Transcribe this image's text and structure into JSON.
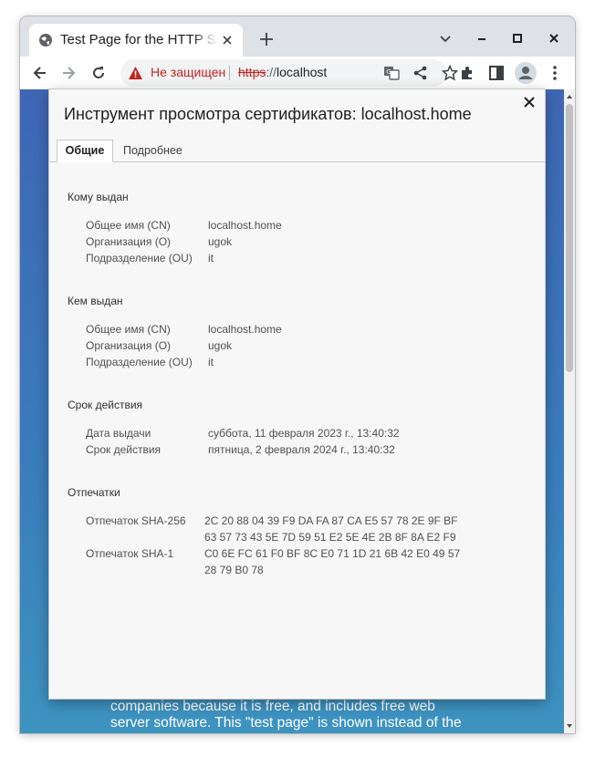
{
  "browser": {
    "tab_title": "Test Page for the HTTP Server on Fedora",
    "security_label": "Не защищен",
    "url_scheme": "https",
    "url_sep": "://",
    "url_host": "localhost"
  },
  "page": {
    "text_lines": [
      "companies because it is free, and includes free web",
      "server software. This \"test page\" is shown instead of the"
    ]
  },
  "dialog": {
    "title": "Инструмент просмотра сертификатов: localhost.home",
    "tabs": [
      "Общие",
      "Подробнее"
    ],
    "issued_to": {
      "title": "Кому выдан",
      "rows": [
        {
          "label": "Общее имя (CN)",
          "value": "localhost.home"
        },
        {
          "label": "Организация (O)",
          "value": "ugok"
        },
        {
          "label": "Подразделение (OU)",
          "value": "it"
        }
      ]
    },
    "issued_by": {
      "title": "Кем выдан",
      "rows": [
        {
          "label": "Общее имя (CN)",
          "value": "localhost.home"
        },
        {
          "label": "Организация (O)",
          "value": "ugok"
        },
        {
          "label": "Подразделение (OU)",
          "value": "it"
        }
      ]
    },
    "validity": {
      "title": "Срок действия",
      "rows": [
        {
          "label": "Дата выдачи",
          "value": "суббота, 11 февраля 2023 г., 13:40:32"
        },
        {
          "label": "Срок действия",
          "value": "пятница, 2 февраля 2024 г., 13:40:32"
        }
      ]
    },
    "fingerprints": {
      "title": "Отпечатки",
      "sha256_label": "Отпечаток SHA-256",
      "sha256_lines": [
        "2C 20 88 04 39 F9 DA FA 87 CA E5 57 78 2E 9F BF",
        "63 57 73 43 5E 7D 59 51 E2 5E 4E 2B 8F 8A E2 F9"
      ],
      "sha1_label": "Отпечаток SHA-1",
      "sha1_lines": [
        "C0 6E FC 61 F0 BF 8C E0 71 1D 21 6B 42 E0 49 57",
        "28 79 B0 78"
      ]
    }
  },
  "colors": {
    "warning_red": "#c5221f",
    "page_gradient_top": "#3f66b4",
    "page_gradient_bottom": "#3d93c0"
  }
}
